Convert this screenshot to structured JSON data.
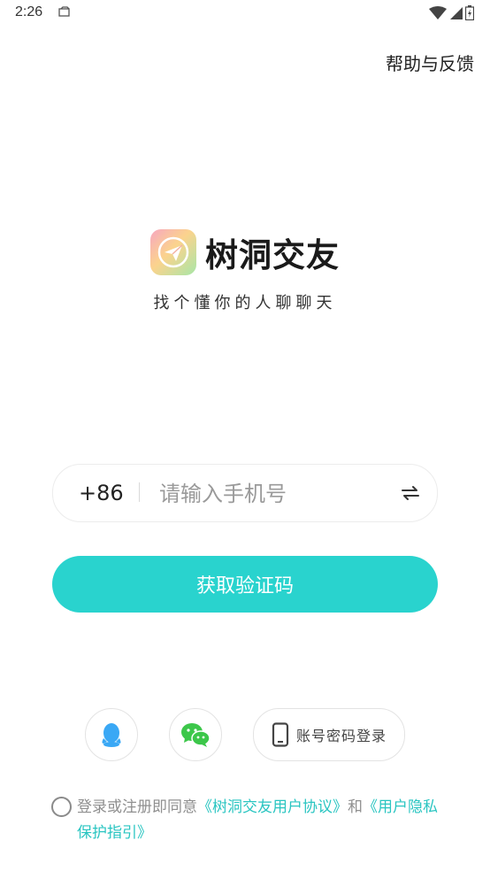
{
  "status_bar": {
    "time": "2:26"
  },
  "header": {
    "help_label": "帮助与反馈"
  },
  "brand": {
    "app_name": "树洞交友",
    "slogan": "找个懂你的人聊聊天"
  },
  "login_form": {
    "country_code": "+86",
    "phone_placeholder": "请输入手机号",
    "phone_value": "",
    "submit_label": "获取验证码"
  },
  "alt_login": {
    "password_login_label": "账号密码登录"
  },
  "agreement": {
    "prefix": "登录或注册即同意",
    "user_agreement": "《树洞交友用户协议》",
    "and": "和",
    "privacy_policy": "《用户隐私保护指引》",
    "checked": false
  },
  "colors": {
    "accent": "#29d3ce",
    "link": "#29c5c1",
    "qq": "#3aa8f5",
    "wechat": "#3cc74a"
  }
}
